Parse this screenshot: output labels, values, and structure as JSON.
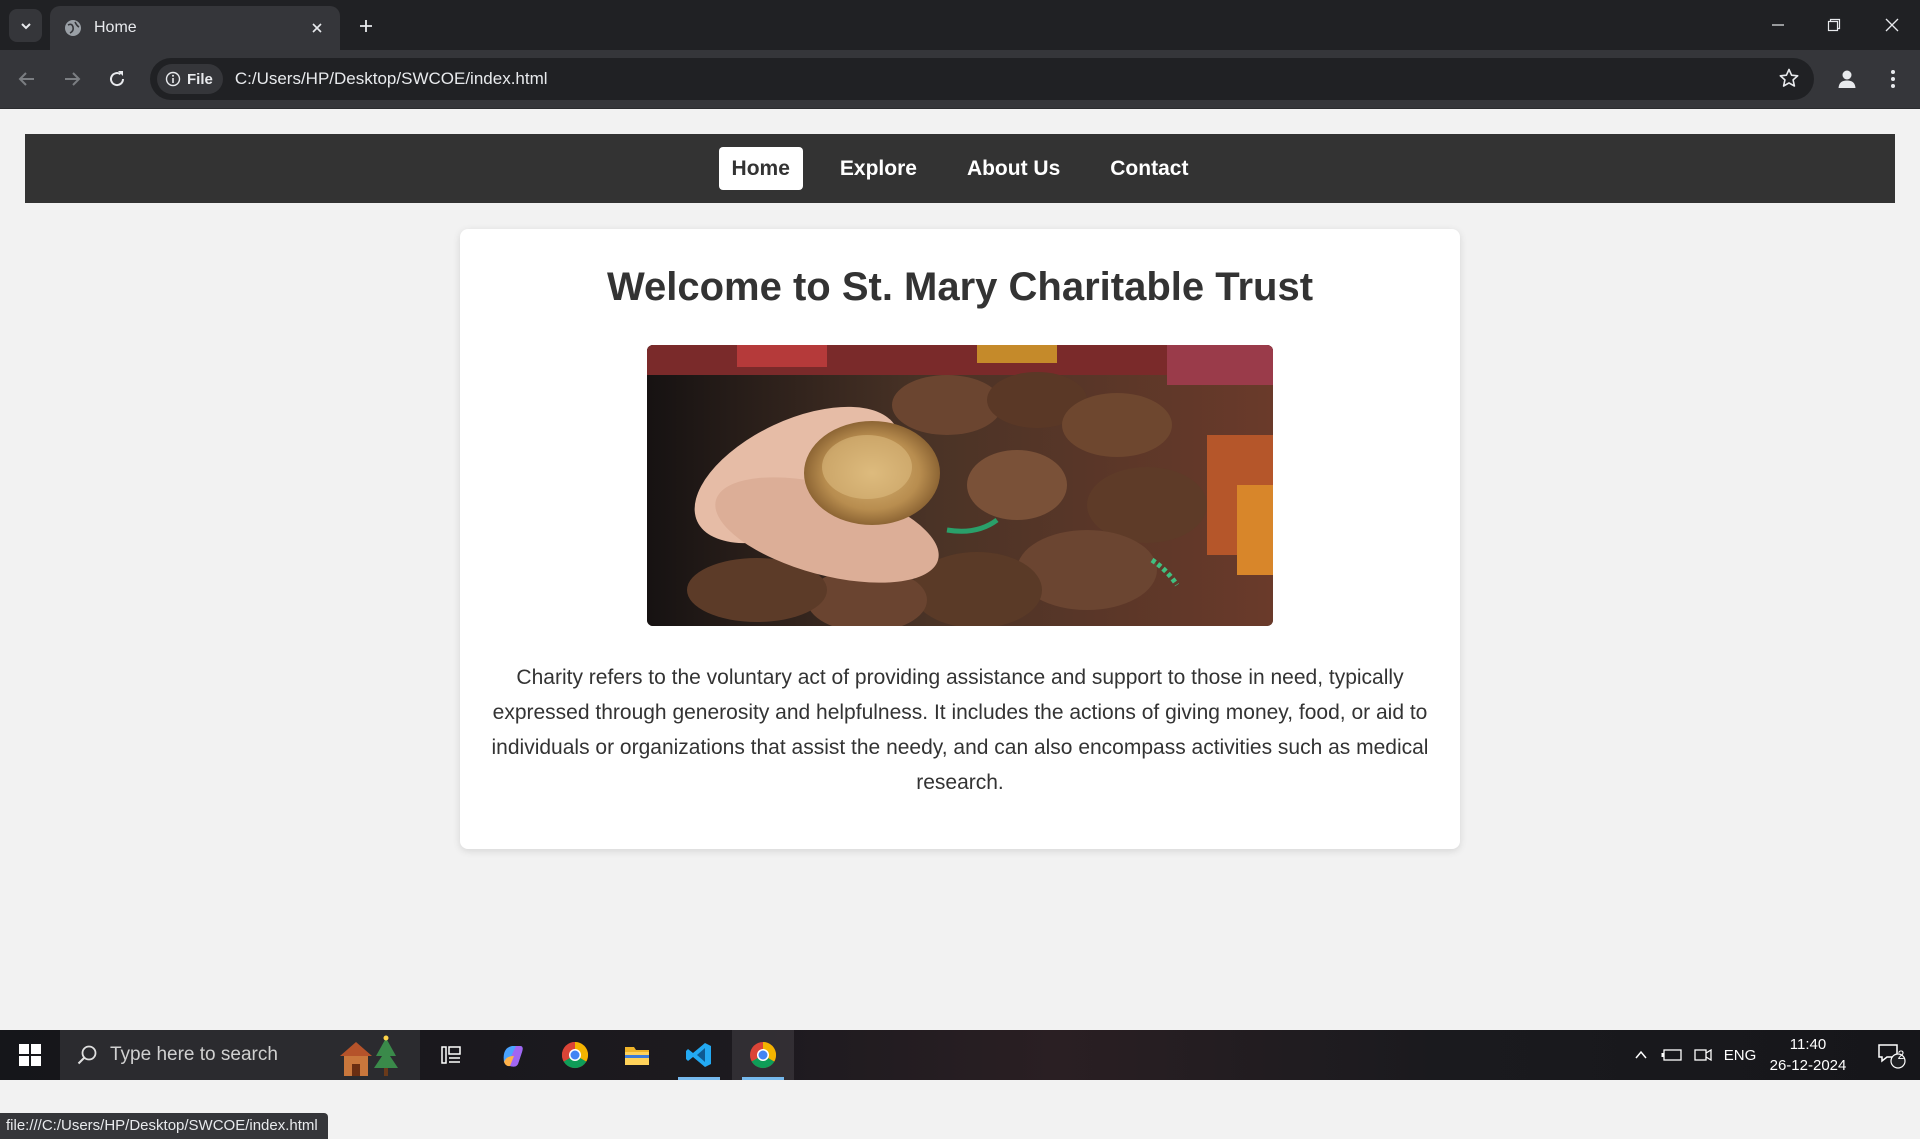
{
  "browser": {
    "tab_title": "Home",
    "omnibox_chip": "File",
    "url": "C:/Users/HP/Desktop/SWCOE/index.html",
    "status_url": "file:///C:/Users/HP/Desktop/SWCOE/index.html"
  },
  "site": {
    "nav": [
      "Home",
      "Explore",
      "About Us",
      "Contact"
    ],
    "active_nav": "Home",
    "heading": "Welcome to St. Mary Charitable Trust",
    "paragraph": "Charity refers to the voluntary act of providing assistance and support to those in need, typically expressed through generosity and helpfulness. It includes the actions of giving money, food, or aid to individuals or organizations that assist the needy, and can also encompass activities such as medical research."
  },
  "taskbar": {
    "search_placeholder": "Type here to search",
    "language": "ENG",
    "time": "11:40",
    "date": "26-12-2024",
    "notification_count": "2"
  },
  "colors": {
    "nav_bg": "#333333",
    "page_bg": "#f2f2f2",
    "card_bg": "#ffffff",
    "chrome_dark": "#202124",
    "chrome_mid": "#35363a"
  }
}
